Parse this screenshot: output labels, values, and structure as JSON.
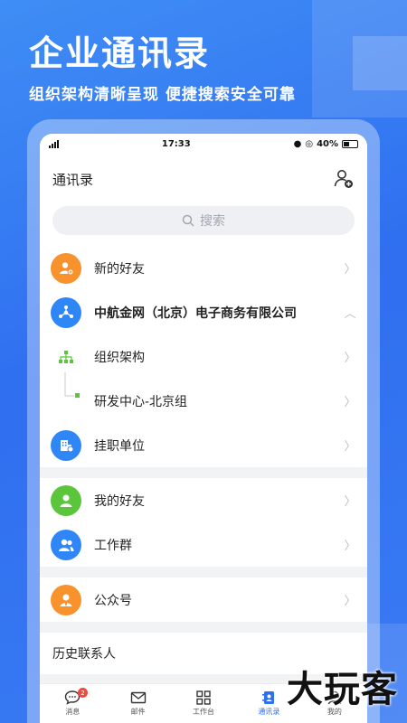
{
  "promo": {
    "headline": "企业通讯录",
    "subline": "组织架构清晰呈现 便捷搜索安全可靠"
  },
  "statusbar": {
    "time": "17:33",
    "battery": "40%"
  },
  "header": {
    "title": "通讯录",
    "add_icon": "add-contact-icon"
  },
  "search": {
    "placeholder": "搜索"
  },
  "rows": {
    "new_friends": "新的好友",
    "company": "中航金网（北京）电子商务有限公司",
    "org_structure": "组织架构",
    "dept": "研发中心-北京组",
    "affiliated": "挂职单位",
    "my_friends": "我的好友",
    "work_groups": "工作群",
    "official_accounts": "公众号"
  },
  "history": {
    "title": "历史联系人"
  },
  "tabs": [
    {
      "label": "消息",
      "icon": "message-icon",
      "badge": "2"
    },
    {
      "label": "邮件",
      "icon": "mail-icon"
    },
    {
      "label": "工作台",
      "icon": "grid-icon"
    },
    {
      "label": "通讯录",
      "icon": "contacts-icon",
      "active": true
    },
    {
      "label": "我的",
      "icon": "user-icon"
    }
  ],
  "watermark": "大玩客",
  "colors": {
    "orange": "#f7922d",
    "blue": "#2f86f6",
    "green": "#5bc63b",
    "brand": "#2f6ff0"
  }
}
